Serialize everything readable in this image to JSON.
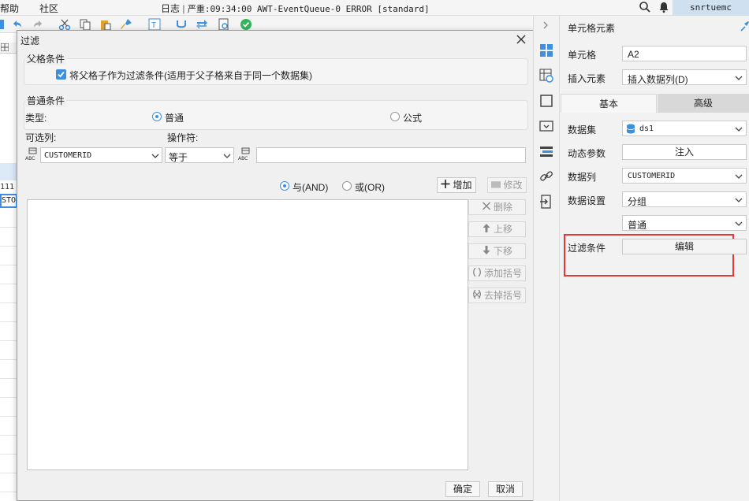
{
  "menubar": {
    "help": "帮助",
    "community": "社区",
    "log_label": "日志",
    "log_separator": "|",
    "log_text": "严重:09:34:00 AWT-EventQueue-0 ERROR [standard]",
    "user": "snrtuemc"
  },
  "leftgrid": {
    "cell1": "111",
    "cell2": "STO"
  },
  "dialog": {
    "title": "过滤",
    "parent_section": {
      "title": "父格条件",
      "checkbox_label": "将父格子作为过滤条件(适用于父子格来自于同一个数据集)",
      "checked": true
    },
    "common_section": {
      "title": "普通条件",
      "type_label": "类型:",
      "type_normal": "普通",
      "type_formula": "公式",
      "available_columns_label": "可选列:",
      "operator_label": "操作符:",
      "column_value": "CUSTOMERID",
      "operator_value": "等于",
      "value_input": ""
    },
    "logic": {
      "and_label": "与(AND)",
      "or_label": "或(OR)",
      "selected": "and"
    },
    "buttons": {
      "add": "增加",
      "modify": "修改",
      "delete": "删除",
      "move_up": "上移",
      "move_down": "下移",
      "add_bracket": "添加括号",
      "remove_bracket": "去掉括号",
      "ok": "确定",
      "cancel": "取消"
    }
  },
  "panel": {
    "title": "单元格元素",
    "cell_label": "单元格",
    "cell_value": "A2",
    "insert_label": "插入元素",
    "insert_value": "插入数据列(D)",
    "tab_basic": "基本",
    "tab_advanced": "高级",
    "dataset_label": "数据集",
    "dataset_value": "ds1",
    "dynamic_param_label": "动态参数",
    "dynamic_param_button": "注入",
    "column_label": "数据列",
    "column_value": "CUSTOMERID",
    "data_setting_label": "数据设置",
    "data_setting_value": "分组",
    "data_setting_sub_value": "普通",
    "filter_label": "过滤条件",
    "filter_button": "编辑"
  },
  "colors": {
    "accent": "#3d8fe0",
    "highlight_border": "#e53935",
    "user_bg": "#cfe0f0"
  }
}
